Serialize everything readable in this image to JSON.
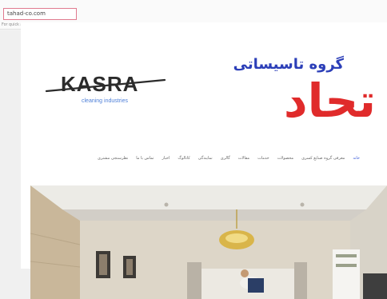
{
  "browser": {
    "url": "tahad-co.com",
    "bookmarks_text": "For quick access, place your bookmarks here on the bookmarks bar.",
    "import_link": "Import bookmarks now..."
  },
  "site": {
    "brand_left": "KASRA",
    "brand_left_sub": "cleaning industries",
    "brand_right_title": "گروه تاسیساتی",
    "brand_right_main": "تحاد",
    "nav": [
      "خانه",
      "معرفی گروه صنایع کسری",
      "محصولات",
      "خدمات",
      "مقالات",
      "گالری",
      "نمایندگی",
      "کاتالوگ",
      "اخبار",
      "تماس با ما",
      "نظرسنجی مشتری"
    ]
  },
  "colors": {
    "accent_red": "#e02b2b",
    "brand_blue": "#2c3fb8",
    "url_border": "#e07a8f",
    "nav_active": "#3a5bd9"
  }
}
